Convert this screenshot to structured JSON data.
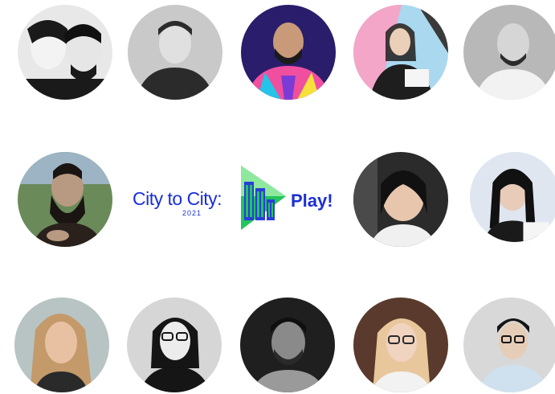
{
  "avatars": [
    {
      "name": "avatar-1",
      "colors": [
        "#e8e8e8",
        "#1a1a1a",
        "#f3f3f3"
      ]
    },
    {
      "name": "avatar-2",
      "colors": [
        "#c9c9c9",
        "#2b2b2b",
        "#e0e0e0"
      ]
    },
    {
      "name": "avatar-3",
      "colors": [
        "#2a1d6b",
        "#1b1b1b",
        "#f04fa0"
      ]
    },
    {
      "name": "avatar-4",
      "colors": [
        "#a9d8ef",
        "#1e1e1e",
        "#f3a6c8"
      ]
    },
    {
      "name": "avatar-5",
      "colors": [
        "#b8b8b8",
        "#2c2c2c",
        "#f2f2f2"
      ]
    },
    {
      "name": "avatar-6",
      "colors": [
        "#6a8a5a",
        "#1a1412",
        "#b89a82"
      ]
    },
    {
      "name": "avatar-7",
      "colors": [
        "#2b2b2b",
        "#111111",
        "#e7c6ad"
      ]
    },
    {
      "name": "avatar-8",
      "colors": [
        "#dfe6f0",
        "#111111",
        "#e8cbb8"
      ]
    },
    {
      "name": "avatar-9",
      "colors": [
        "#b8c4c4",
        "#c49a6b",
        "#e8c1a3"
      ]
    },
    {
      "name": "avatar-10",
      "colors": [
        "#d6d6d6",
        "#151515",
        "#ececec"
      ]
    },
    {
      "name": "avatar-11",
      "colors": [
        "#1f1f1f",
        "#0f0f0f",
        "#8a8a8a"
      ]
    },
    {
      "name": "avatar-12",
      "colors": [
        "#5a3a2c",
        "#e9c79c",
        "#f0d4c0"
      ]
    },
    {
      "name": "avatar-13",
      "colors": [
        "#d8d8d8",
        "#141414",
        "#cfe0ef"
      ]
    }
  ],
  "logo": {
    "left_text": "City to City:",
    "year": "2021",
    "right_text": "Play!",
    "colors": {
      "text": "#1b2fd6",
      "mark_dark": "#2a3dd9",
      "mark_green": "#22c55e",
      "mark_light": "#8ee89e"
    }
  }
}
